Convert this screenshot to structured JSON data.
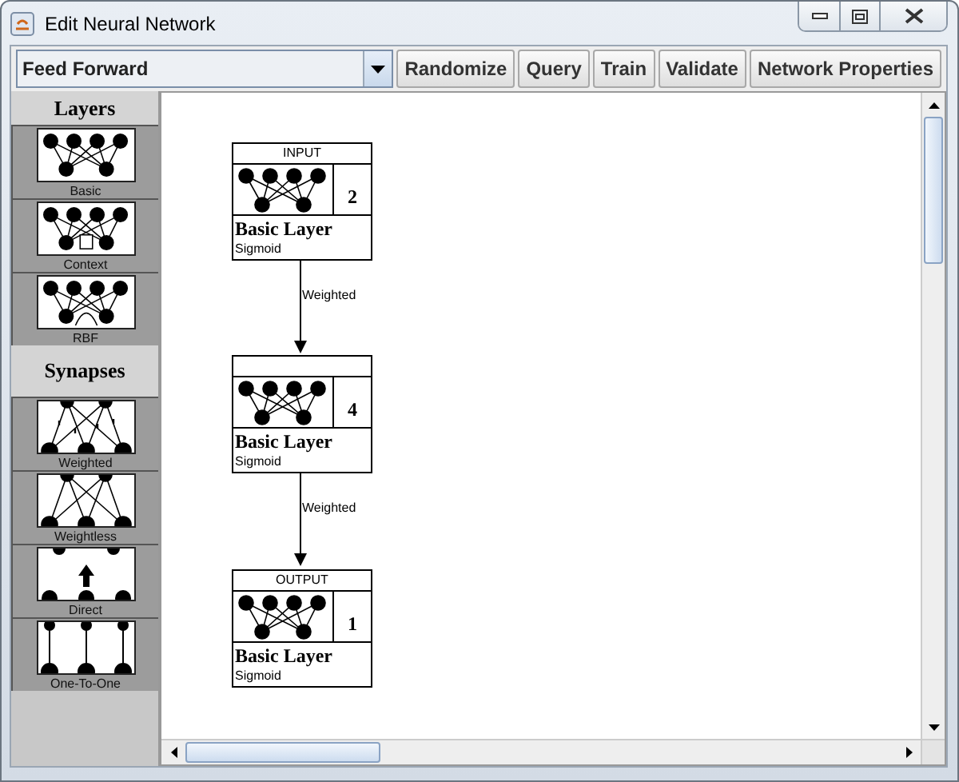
{
  "window": {
    "title": "Edit Neural Network"
  },
  "toolbar": {
    "network_type": "Feed Forward",
    "buttons": [
      "Randomize",
      "Query",
      "Train",
      "Validate",
      "Network Properties"
    ]
  },
  "palette": [
    {
      "title": "Layers",
      "items": [
        {
          "label": "Basic",
          "kind": "basic"
        },
        {
          "label": "Context",
          "kind": "context"
        },
        {
          "label": "RBF",
          "kind": "rbf"
        }
      ]
    },
    {
      "title": "Synapses",
      "items": [
        {
          "label": "Weighted",
          "kind": "weighted"
        },
        {
          "label": "Weightless",
          "kind": "weightless"
        },
        {
          "label": "Direct",
          "kind": "direct"
        },
        {
          "label": "One-To-One",
          "kind": "onetoone"
        }
      ]
    }
  ],
  "layers": [
    {
      "header": "INPUT",
      "neurons": "2",
      "title": "Basic Layer",
      "activation": "Sigmoid"
    },
    {
      "neurons": "4",
      "title": "Basic Layer",
      "activation": "Sigmoid"
    },
    {
      "header": "OUTPUT",
      "neurons": "1",
      "title": "Basic Layer",
      "activation": "Sigmoid"
    }
  ],
  "connections": [
    {
      "label": "Weighted"
    },
    {
      "label": "Weighted"
    }
  ]
}
